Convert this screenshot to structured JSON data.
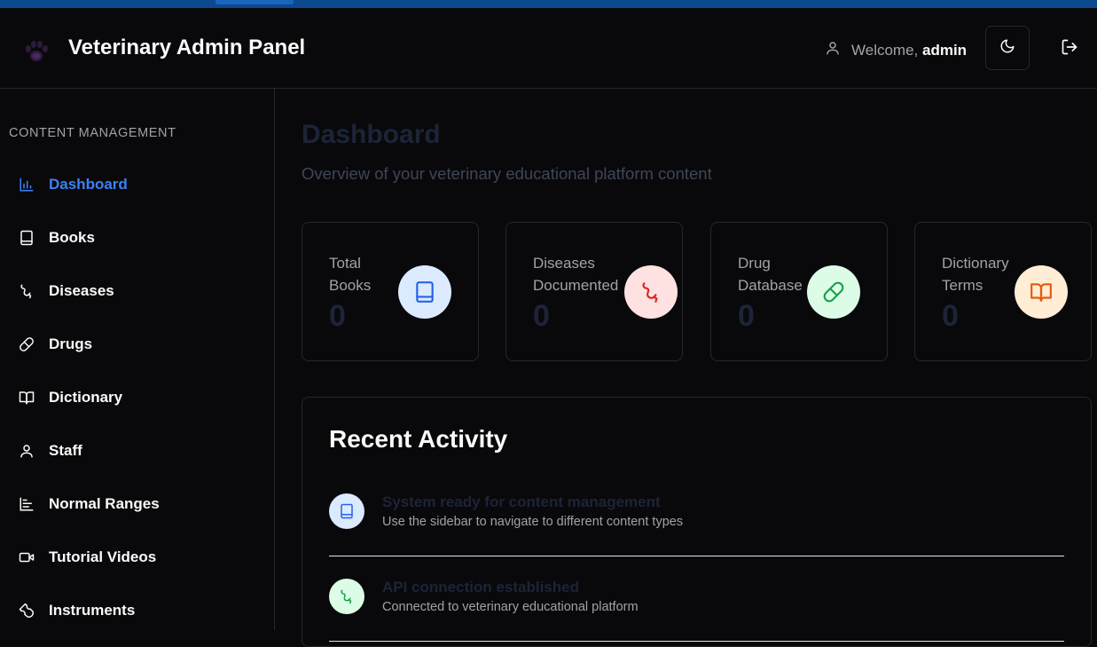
{
  "header": {
    "app_title": "Veterinary Admin Panel",
    "welcome_text": "Welcome,",
    "username": "admin",
    "logo_icon": "paw-icon",
    "theme_toggle_icon": "moon-icon",
    "logout_icon": "logout-icon"
  },
  "sidebar": {
    "section_label": "CONTENT MANAGEMENT",
    "items": [
      {
        "label": "Dashboard",
        "icon": "bar-chart-icon",
        "active": true
      },
      {
        "label": "Books",
        "icon": "book-icon"
      },
      {
        "label": "Diseases",
        "icon": "worm-icon"
      },
      {
        "label": "Drugs",
        "icon": "pill-icon"
      },
      {
        "label": "Dictionary",
        "icon": "book-open-icon"
      },
      {
        "label": "Staff",
        "icon": "user-icon"
      },
      {
        "label": "Normal Ranges",
        "icon": "chart-icon"
      },
      {
        "label": "Tutorial Videos",
        "icon": "video-icon"
      },
      {
        "label": "Instruments",
        "icon": "wrench-icon"
      }
    ]
  },
  "main": {
    "title": "Dashboard",
    "subtitle": "Overview of your veterinary educational platform content",
    "stats": [
      {
        "label_line1": "Total",
        "label_line2": "Books",
        "value": "0",
        "icon": "book-icon",
        "icon_color": "#2563eb",
        "icon_bg": "#dbeafe"
      },
      {
        "label_line1": "Diseases",
        "label_line2": "Documented",
        "value": "0",
        "icon": "worm-icon",
        "icon_color": "#dc2626",
        "icon_bg": "#fee2e2"
      },
      {
        "label_line1": "Drug",
        "label_line2": "Database",
        "value": "0",
        "icon": "pill-icon",
        "icon_color": "#16a34a",
        "icon_bg": "#dcfce7"
      },
      {
        "label_line1": "Dictionary",
        "label_line2": "Terms",
        "value": "0",
        "icon": "book-open-icon",
        "icon_color": "#ea580c",
        "icon_bg": "#ffedd5"
      }
    ],
    "recent_activity": {
      "title": "Recent Activity",
      "items": [
        {
          "title": "System ready for content management",
          "description": "Use the sidebar to navigate to different content types",
          "icon": "book-icon",
          "icon_color": "#2563eb",
          "icon_bg": "#dbeafe"
        },
        {
          "title": "API connection established",
          "description": "Connected to veterinary educational platform",
          "icon": "worm-icon",
          "icon_color": "#16a34a",
          "icon_bg": "#dcfce7"
        }
      ]
    }
  },
  "colors": {
    "accent": "#3b82f6",
    "background": "#09090b",
    "border": "#27272a",
    "muted_text": "#a1a1aa"
  }
}
